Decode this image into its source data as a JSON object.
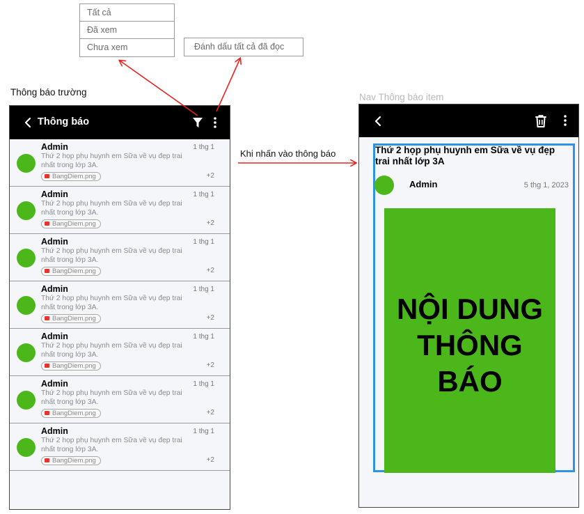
{
  "filter_menu": {
    "options": [
      "Tất cả",
      "Đã xem",
      "Chưa xem"
    ]
  },
  "mark_all_read": "Đánh dấu tất cả đã đọc",
  "left_screen": {
    "label": "Thông báo trường",
    "title": "Thông báo",
    "notifications": [
      {
        "sender": "Admin",
        "date": "1 thg 1",
        "preview": "Thứ 2 họp phụ huynh em Sữa về vụ đẹp trai nhất trong lớp 3A.",
        "attachment": "BangDiem.png",
        "more": "+2"
      },
      {
        "sender": "Admin",
        "date": "1 thg 1",
        "preview": "Thứ 2 họp phụ huynh em Sữa về vụ đẹp trai nhất trong lớp 3A.",
        "attachment": "BangDiem.png",
        "more": "+2"
      },
      {
        "sender": "Admin",
        "date": "1 thg 1",
        "preview": "Thứ 2 họp phụ huynh em Sữa về vụ đẹp trai nhất trong lớp 3A.",
        "attachment": "BangDiem.png",
        "more": "+2"
      },
      {
        "sender": "Admin",
        "date": "1 thg 1",
        "preview": "Thứ 2 họp phụ huynh em Sữa về vụ đẹp trai nhất trong lớp 3A.",
        "attachment": "BangDiem.png",
        "more": "+2"
      },
      {
        "sender": "Admin",
        "date": "1 thg 1",
        "preview": "Thứ 2 họp phụ huynh em Sữa về vụ đẹp trai nhất trong lớp 3A.",
        "attachment": "BangDiem.png",
        "more": "+2"
      },
      {
        "sender": "Admin",
        "date": "1 thg 1",
        "preview": "Thứ 2 họp phụ huynh em Sữa về vụ đẹp trai nhất trong lớp 3A.",
        "attachment": "BangDiem.png",
        "more": "+2"
      },
      {
        "sender": "Admin",
        "date": "1 thg 1",
        "preview": "Thứ 2 họp phụ huynh em Sữa về vụ đẹp trai nhất trong lớp 3A.",
        "attachment": "BangDiem.png",
        "more": "+2"
      }
    ]
  },
  "flow_label": "Khi nhấn vào thông báo",
  "right_screen": {
    "label": "Nav Thông báo item",
    "title": "Thứ 2 họp phụ huynh em Sữa về vụ đẹp trai nhất lớp 3A",
    "sender": "Admin",
    "date": "5 thg 1, 2023",
    "content": "NỘI DUNG THÔNG BÁO"
  },
  "colors": {
    "topbar": "#000000",
    "avatar": "#4cb71b",
    "content_bg": "#4cb71b",
    "selection_border": "#2f93e3",
    "arrow": "#e8231e",
    "screen_bg": "#f4f6f9"
  },
  "icons": [
    "chevron-left-icon",
    "filter-icon",
    "more-vertical-icon",
    "trash-icon",
    "image-icon"
  ]
}
